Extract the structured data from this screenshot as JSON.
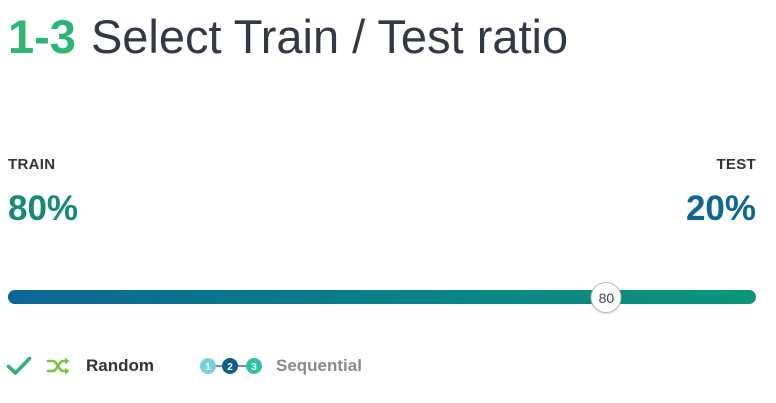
{
  "header": {
    "step": "1-3",
    "title": "Select Train / Test ratio"
  },
  "train": {
    "label": "TRAIN",
    "percent_text": "80%",
    "color": "#138a7a"
  },
  "test": {
    "label": "TEST",
    "percent_text": "20%",
    "color": "#0c6695"
  },
  "slider": {
    "value": 80,
    "value_text": "80",
    "min": 0,
    "max": 100,
    "gradient_start": "#0c6695",
    "gradient_end": "#0d9478"
  },
  "split_options": {
    "selected": "random",
    "random": {
      "label": "Random",
      "icon": "shuffle-icon",
      "checked": true
    },
    "sequential": {
      "label": "Sequential",
      "icon": "numbered-steps-icon",
      "step_numbers": [
        "1",
        "2",
        "3"
      ]
    }
  },
  "colors": {
    "accent_green": "#2bb673",
    "title_text": "#323845"
  }
}
